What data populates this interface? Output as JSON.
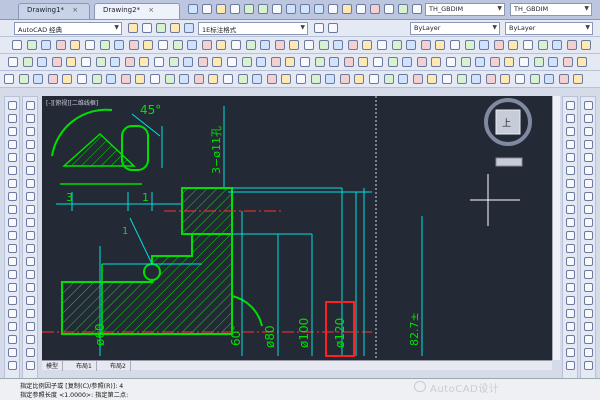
{
  "tabs": [
    {
      "label": "Drawing1*",
      "close": "×"
    },
    {
      "label": "Drawing2*",
      "close": "×"
    }
  ],
  "toolbar": {
    "workspace": "AutoCAD 经典",
    "style_name": "TH_GBDIM",
    "style_name2": "TH_GBDIM",
    "layer_select": "ByLayer",
    "linetype_select": "ByLayer",
    "annotate_label": "1E标注格式"
  },
  "viewport": {
    "label": "[-][俯视][二维线框]",
    "cube_face": "上"
  },
  "drawing": {
    "angle_label": "45°",
    "hole_callout": "3−ø11孔",
    "dim_3": "3",
    "dim_1": "1",
    "d60": "ø60",
    "d80": "ø80",
    "d100": "ø100",
    "d120": "ø120",
    "angle60": "60°",
    "right_dim": "82.7±",
    "leader_label": "1"
  },
  "layout_tabs": [
    "模型",
    "布局1",
    "布局2"
  ],
  "command": {
    "line1": "指定比例因子或 [复制(C)/参照(R)]: 4",
    "line2": "指定参照长度 <1.0000>:  指定第二点:"
  },
  "watermark": "AutoCAD设计",
  "colors": {
    "canvas": "#232a36",
    "geometry": "#00e000",
    "hatch": "#00e000",
    "dimension": "#00e0e0",
    "centerline": "#ff3030",
    "highlight_box": "#ff2020"
  }
}
